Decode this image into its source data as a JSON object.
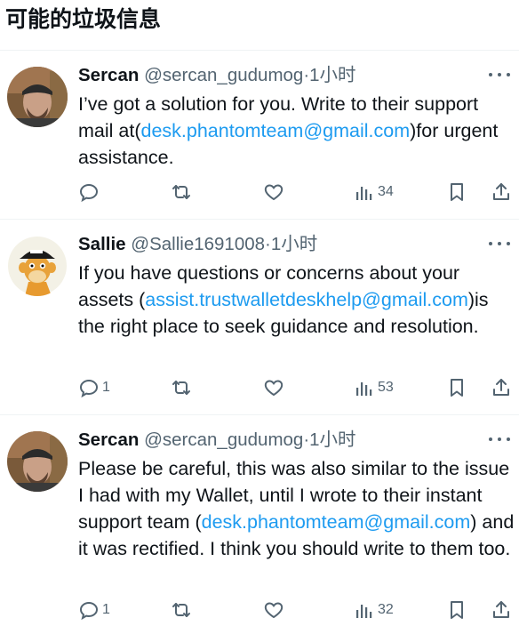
{
  "header": {
    "title": "可能的垃圾信息"
  },
  "tweets": [
    {
      "name": "Sercan",
      "handle": "@sercan_gudumog",
      "dot": "·",
      "time": "1小时",
      "text_before": "I’ve got a solution for you. Write to their support mail at(",
      "link": "desk.phantomteam@gmail.com",
      "text_after": ")for urgent assistance.",
      "replies": "",
      "views": "34"
    },
    {
      "name": "Sallie",
      "handle": "@Sallie1691008",
      "dot": "·",
      "time": "1小时",
      "text_before": "If you have questions or concerns about your assets (",
      "link": "assist.trustwalletdeskhelp@gmail.com",
      "text_after": ")is the right place to seek guidance and resolution.",
      "replies": "1",
      "views": "53"
    },
    {
      "name": "Sercan",
      "handle": "@sercan_gudumog",
      "dot": "·",
      "time": "1小时",
      "text_before": "Please be careful, this was also similar to the issue I had with my Wallet, until I wrote to their instant support team (",
      "link": "desk.phantomteam@gmail.com",
      "text_after": ") and it was rectified. I think you should write to them too.",
      "replies": "1",
      "views": "32"
    }
  ],
  "colors": {
    "link": "#1d9bf0",
    "muted": "#536471",
    "text": "#0f1419"
  }
}
